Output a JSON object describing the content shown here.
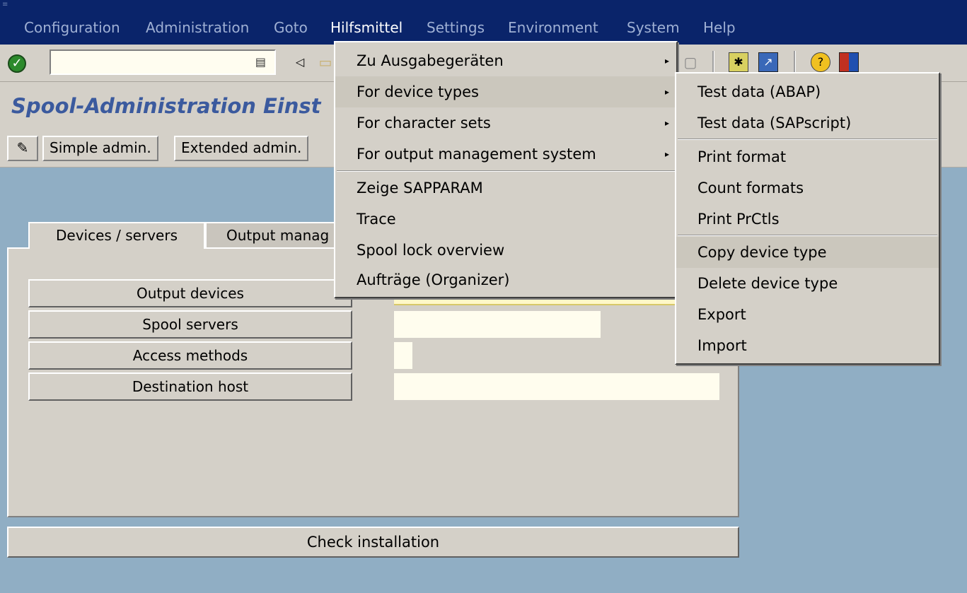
{
  "menubar": {
    "items": [
      "Configuration",
      "Administration",
      "Goto",
      "Hilfsmittel",
      "Settings",
      "Environment",
      "System",
      "Help"
    ]
  },
  "title": "Spool-Administration Einst",
  "app_toolbar": {
    "simple_admin": "Simple admin.",
    "extended_admin": "Extended admin."
  },
  "tabs": [
    "Devices / servers",
    "Output manag"
  ],
  "panel_buttons": [
    "Output devices",
    "Spool servers",
    "Access methods",
    "Destination host"
  ],
  "check_installation": "Check installation",
  "hilfsmittel_menu": {
    "items": [
      "Zu Ausgabegeräten",
      "For device types",
      "For character sets",
      "For output management system",
      "Zeige SAPPARAM",
      "Trace",
      "Spool lock overview",
      "Aufträge (Organizer)"
    ],
    "highlighted": "For device types"
  },
  "device_types_submenu": {
    "items": [
      "Test data (ABAP)",
      "Test data (SAPscript)",
      "Print format",
      "Count formats",
      "Print PrCtls",
      "Copy device type",
      "Delete device type",
      "Export",
      "Import"
    ],
    "highlighted": "Copy device type"
  },
  "colors": {
    "menubar_bg": "#0a246a",
    "workspace_bg": "#90aec4",
    "title_color": "#3b5a9e",
    "input_bg": "#fffdee"
  }
}
